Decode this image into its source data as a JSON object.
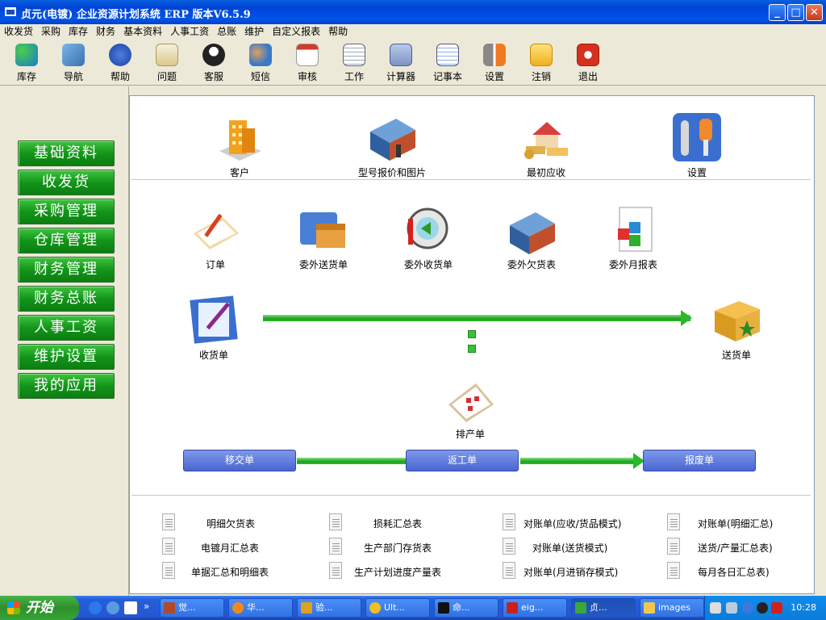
{
  "window": {
    "title": "贞元(电镀) 企业资源计划系统 ERP 版本V6.5.9",
    "min": "_",
    "max": "□",
    "close": "✕"
  },
  "menu": [
    "收发货",
    "采购",
    "库存",
    "财务",
    "基本资料",
    "人事工资",
    "总账",
    "维护",
    "自定义报表",
    "帮助"
  ],
  "toolbar": [
    {
      "label": "库存",
      "icon": "cubes-icon"
    },
    {
      "label": "导航",
      "icon": "navigation-icon"
    },
    {
      "label": "帮助",
      "icon": "help-icon"
    },
    {
      "label": "问题",
      "icon": "mail-question-icon"
    },
    {
      "label": "客服",
      "icon": "qq-penguin-icon"
    },
    {
      "label": "短信",
      "icon": "users-icon"
    },
    {
      "label": "审核",
      "icon": "calendar-check-icon"
    },
    {
      "label": "工作",
      "icon": "calendar-icon"
    },
    {
      "label": "计算器",
      "icon": "calculator-icon"
    },
    {
      "label": "记事本",
      "icon": "notepad-icon"
    },
    {
      "label": "设置",
      "icon": "tools-icon"
    },
    {
      "label": "注销",
      "icon": "key-icon"
    },
    {
      "label": "退出",
      "icon": "power-icon"
    }
  ],
  "nav": [
    "基础资料",
    "收发货",
    "采购管理",
    "仓库管理",
    "财务管理",
    "财务总账",
    "人事工资",
    "维护设置",
    "我的应用"
  ],
  "top_items": [
    "客户",
    "型号报价和图片",
    "最初应收",
    "设置"
  ],
  "mid_items": [
    "订单",
    "委外送货单",
    "委外收货单",
    "委外欠货表",
    "委外月报表"
  ],
  "flow": {
    "receive": "收货单",
    "send": "送货单",
    "schedule": "排产单",
    "transfer": "移交单",
    "rework": "返工单",
    "scrap": "报废单"
  },
  "reports": [
    [
      "明细欠货表",
      "损耗汇总表",
      "对账单(应收/货品模式)",
      "对账单(明细汇总)"
    ],
    [
      "电镀月汇总表",
      "生产部门存货表",
      "对账单(送货模式)",
      "送货/产量汇总表)"
    ],
    [
      "单据汇总和明细表",
      "生产计划进度产量表",
      "对账单(月进销存模式)",
      "每月各日汇总表)"
    ]
  ],
  "taskbar": {
    "start": "开始",
    "tasks": [
      "觉...",
      "华...",
      "验...",
      "Ult...",
      "命...",
      "eig...",
      "贞...",
      "images"
    ],
    "clock": "10:28"
  }
}
